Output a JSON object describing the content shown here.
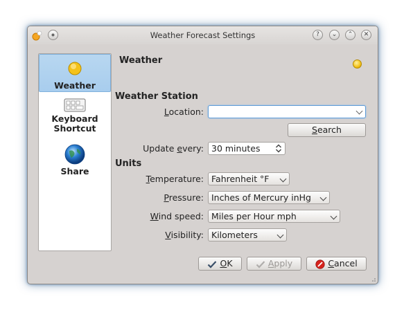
{
  "window": {
    "title": "Weather Forecast Settings"
  },
  "titlebar": {
    "buttons": [
      {
        "name": "help",
        "glyph": "?"
      },
      {
        "name": "minimize",
        "glyph": "⌄"
      },
      {
        "name": "maximize",
        "glyph": "⌃"
      },
      {
        "name": "close",
        "glyph": "✕"
      }
    ]
  },
  "sidebar": {
    "items": [
      {
        "label": "Weather",
        "icon": "sun-icon",
        "selected": true
      },
      {
        "label_line1": "Keyboard",
        "label_line2": "Shortcut",
        "icon": "keyboard-icon"
      },
      {
        "label": "Share",
        "icon": "globe-icon"
      }
    ]
  },
  "panel": {
    "title": "Weather",
    "icon": "weather-status-icon"
  },
  "weather_station": {
    "heading": "Weather Station",
    "location_label_u": "L",
    "location_label_rest": "ocation:",
    "location_value": "",
    "search_label_u": "S",
    "search_label_rest": "earch",
    "update_label_pre": "Update ",
    "update_label_u": "e",
    "update_label_post": "very:",
    "update_value": "30 minutes"
  },
  "units": {
    "heading": "Units",
    "temperature_label_u": "T",
    "temperature_label_rest": "emperature:",
    "temperature_value": "Fahrenheit °F",
    "pressure_label_u": "P",
    "pressure_label_rest": "ressure:",
    "pressure_value": "Inches of Mercury inHg",
    "wind_label_u": "W",
    "wind_label_rest": "ind speed:",
    "wind_value": "Miles per Hour mph",
    "visibility_label_u": "V",
    "visibility_label_rest": "isibility:",
    "visibility_value": "Kilometers"
  },
  "footer": {
    "ok_u": "O",
    "ok_rest": "K",
    "apply_u": "A",
    "apply_rest": "pply",
    "cancel_u": "C",
    "cancel_rest": "ancel",
    "apply_enabled": false
  },
  "colors": {
    "selection": "#a8cdee",
    "focus": "#5e9bd6"
  }
}
